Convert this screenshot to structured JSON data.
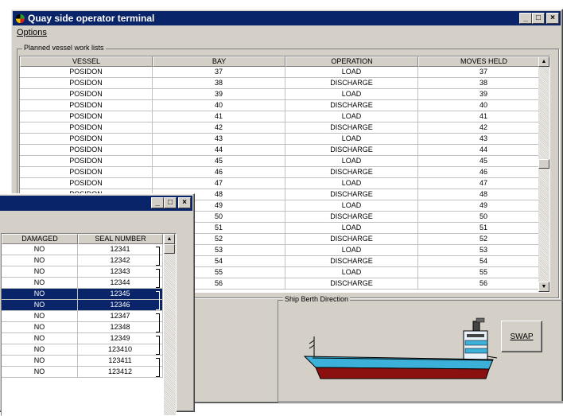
{
  "main_window": {
    "title": "Quay side operator terminal",
    "menu": [
      {
        "label": "Options"
      }
    ]
  },
  "planned_list": {
    "label": "Planned vessel work lists",
    "columns": [
      "VESSEL",
      "BAY",
      "OPERATION",
      "MOVES HELD"
    ],
    "rows": [
      [
        "POSIDON",
        "37",
        "LOAD",
        "37"
      ],
      [
        "POSIDON",
        "38",
        "DISCHARGE",
        "38"
      ],
      [
        "POSIDON",
        "39",
        "LOAD",
        "39"
      ],
      [
        "POSIDON",
        "40",
        "DISCHARGE",
        "40"
      ],
      [
        "POSIDON",
        "41",
        "LOAD",
        "41"
      ],
      [
        "POSIDON",
        "42",
        "DISCHARGE",
        "42"
      ],
      [
        "POSIDON",
        "43",
        "LOAD",
        "43"
      ],
      [
        "POSIDON",
        "44",
        "DISCHARGE",
        "44"
      ],
      [
        "POSIDON",
        "45",
        "LOAD",
        "45"
      ],
      [
        "POSIDON",
        "46",
        "DISCHARGE",
        "46"
      ],
      [
        "POSIDON",
        "47",
        "LOAD",
        "47"
      ],
      [
        "POSIDON",
        "48",
        "DISCHARGE",
        "48"
      ],
      [
        "",
        "49",
        "LOAD",
        "49"
      ],
      [
        "",
        "50",
        "DISCHARGE",
        "50"
      ],
      [
        "",
        "51",
        "LOAD",
        "51"
      ],
      [
        "",
        "52",
        "DISCHARGE",
        "52"
      ],
      [
        "",
        "53",
        "LOAD",
        "53"
      ],
      [
        "",
        "54",
        "DISCHARGE",
        "54"
      ],
      [
        "",
        "55",
        "LOAD",
        "55"
      ],
      [
        "",
        "56",
        "DISCHARGE",
        "56"
      ]
    ]
  },
  "ship_berth": {
    "label": "Ship Berth Direction",
    "swap_label": "SWAP"
  },
  "container_window": {
    "columns": [
      "DAMAGED",
      "SEAL NUMBER"
    ],
    "rows": [
      {
        "damaged": "NO",
        "seal": "12341",
        "selected": false
      },
      {
        "damaged": "NO",
        "seal": "12342",
        "selected": false
      },
      {
        "damaged": "NO",
        "seal": "12343",
        "selected": false
      },
      {
        "damaged": "NO",
        "seal": "12344",
        "selected": false
      },
      {
        "damaged": "NO",
        "seal": "12345",
        "selected": true
      },
      {
        "damaged": "NO",
        "seal": "12346",
        "selected": true
      },
      {
        "damaged": "NO",
        "seal": "12347",
        "selected": false
      },
      {
        "damaged": "NO",
        "seal": "12348",
        "selected": false
      },
      {
        "damaged": "NO",
        "seal": "12349",
        "selected": false
      },
      {
        "damaged": "NO",
        "seal": "123410",
        "selected": false
      },
      {
        "damaged": "NO",
        "seal": "123411",
        "selected": false
      },
      {
        "damaged": "NO",
        "seal": "123412",
        "selected": false
      }
    ]
  },
  "colors": {
    "titlebar": "#0a246a",
    "selection": "#0a246a",
    "ship_hull_top": "#3bb0d8",
    "ship_hull_bottom": "#8b1010"
  }
}
